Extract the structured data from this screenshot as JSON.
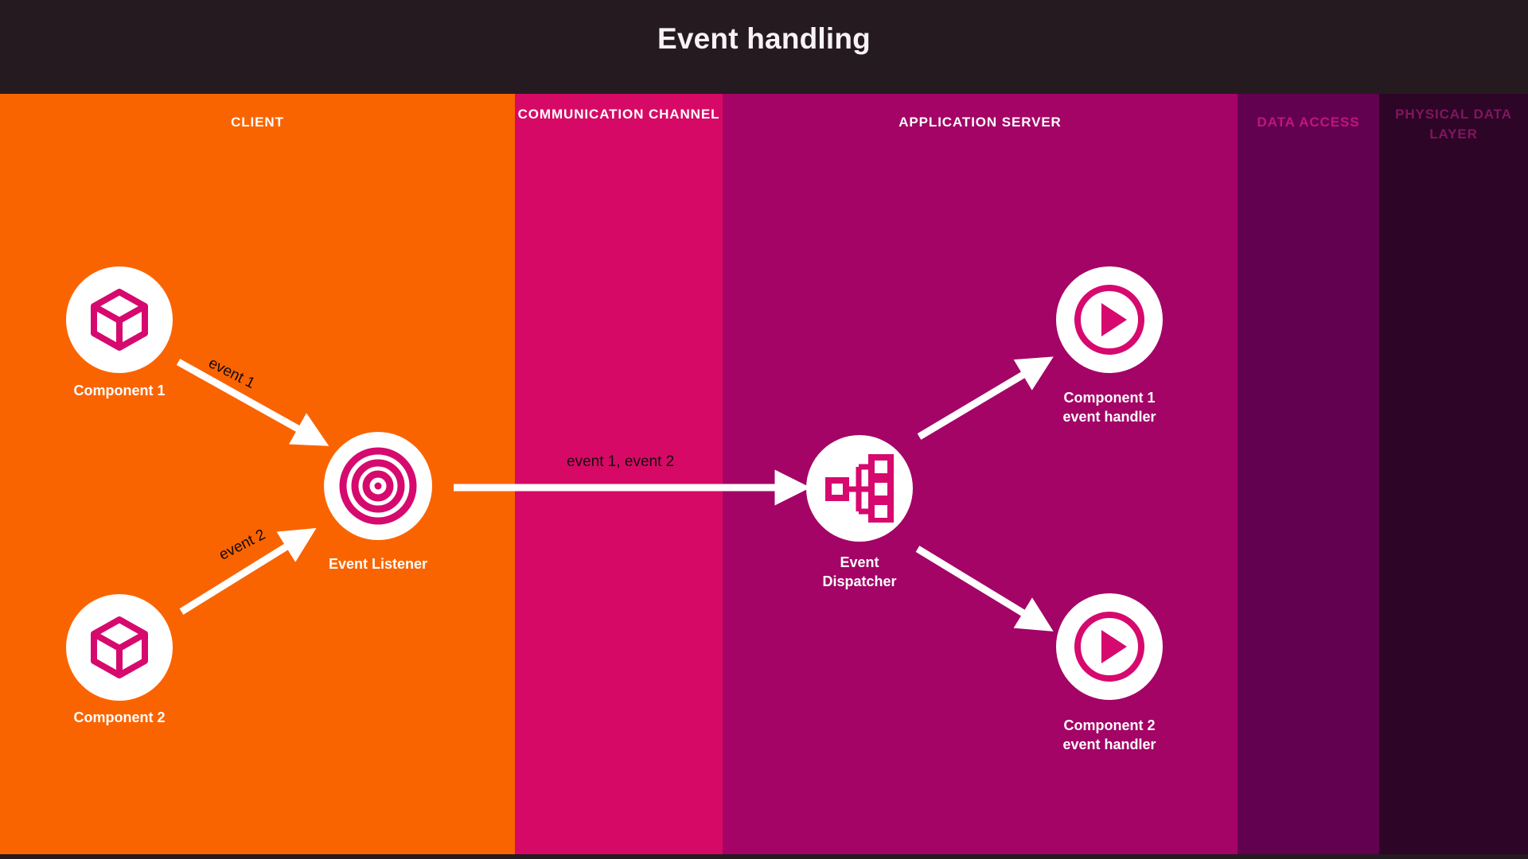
{
  "header": {
    "title": "Event handling"
  },
  "palette": {
    "header_bg": "#261a21",
    "client": "#fa6400",
    "channel": "#d60a66",
    "app_server": "#a30466",
    "data_access": "#62014f",
    "physical_data_layer": "#2d0526",
    "icon_pink": "#d6096e",
    "node_disc": "#ffffff",
    "arrow": "#ffffff",
    "label_text": "#ffffff",
    "dim_label_data_access": "#c2157c",
    "dim_label_physical": "#82155f",
    "arrow_label_text": "#14090d"
  },
  "lanes": [
    {
      "id": "client",
      "label": "CLIENT",
      "state": "active"
    },
    {
      "id": "channel",
      "label": "COMMUNICATION\nCHANNEL",
      "state": "active"
    },
    {
      "id": "appserver",
      "label": "APPLICATION SERVER",
      "state": "active"
    },
    {
      "id": "dataaccess",
      "label": "DATA ACCESS",
      "state": "dimmed"
    },
    {
      "id": "physical",
      "label": "PHYSICAL\nDATA LAYER",
      "state": "dimmed"
    }
  ],
  "nodes": [
    {
      "id": "component-1",
      "label": "Component 1",
      "icon": "cube-icon",
      "lane": "client"
    },
    {
      "id": "component-2",
      "label": "Component 2",
      "icon": "cube-icon",
      "lane": "client"
    },
    {
      "id": "event-listener",
      "label": "Event Listener",
      "icon": "bullseye-icon",
      "lane": "client"
    },
    {
      "id": "event-dispatcher",
      "label": "Event\nDispatcher",
      "icon": "hierarchy-icon",
      "lane": "appserver"
    },
    {
      "id": "component-1-handler",
      "label": "Component 1\nevent handler",
      "icon": "play-icon",
      "lane": "appserver"
    },
    {
      "id": "component-2-handler",
      "label": "Component 2\nevent handler",
      "icon": "play-icon",
      "lane": "appserver"
    }
  ],
  "flows": [
    {
      "id": "flow-event-1",
      "label": "event 1",
      "from": "component-1",
      "to": "event-listener"
    },
    {
      "id": "flow-event-2",
      "label": "event 2",
      "from": "component-2",
      "to": "event-listener"
    },
    {
      "id": "flow-events-channel",
      "label": "event 1, event 2",
      "from": "event-listener",
      "to": "event-dispatcher"
    },
    {
      "id": "flow-dispatch-1",
      "label": "",
      "from": "event-dispatcher",
      "to": "component-1-handler"
    },
    {
      "id": "flow-dispatch-2",
      "label": "",
      "from": "event-dispatcher",
      "to": "component-2-handler"
    }
  ]
}
